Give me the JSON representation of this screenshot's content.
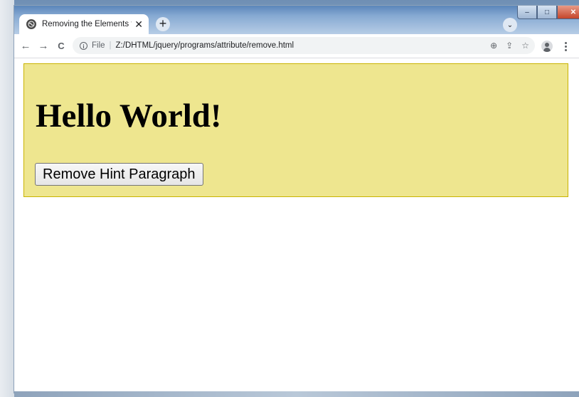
{
  "tab": {
    "title": "Removing the Elements from DOM",
    "close": "✕"
  },
  "titlebar": {
    "new_tab": "+",
    "tab_search": "⌄",
    "minimize": "–",
    "maximize": "□",
    "close": "✕"
  },
  "toolbar": {
    "back": "←",
    "forward": "→",
    "reload": "C",
    "info": "i",
    "scheme": "File",
    "separator": "|",
    "url": "Z:/DHTML/jquery/programs/attribute/remove.html",
    "zoom": "⊕",
    "share": "⇪",
    "bookmark": "☆"
  },
  "page": {
    "heading": "Hello World!",
    "button_label": "Remove Hint Paragraph"
  },
  "colors": {
    "box_background": "#eee68f",
    "box_border": "#c9b300"
  }
}
